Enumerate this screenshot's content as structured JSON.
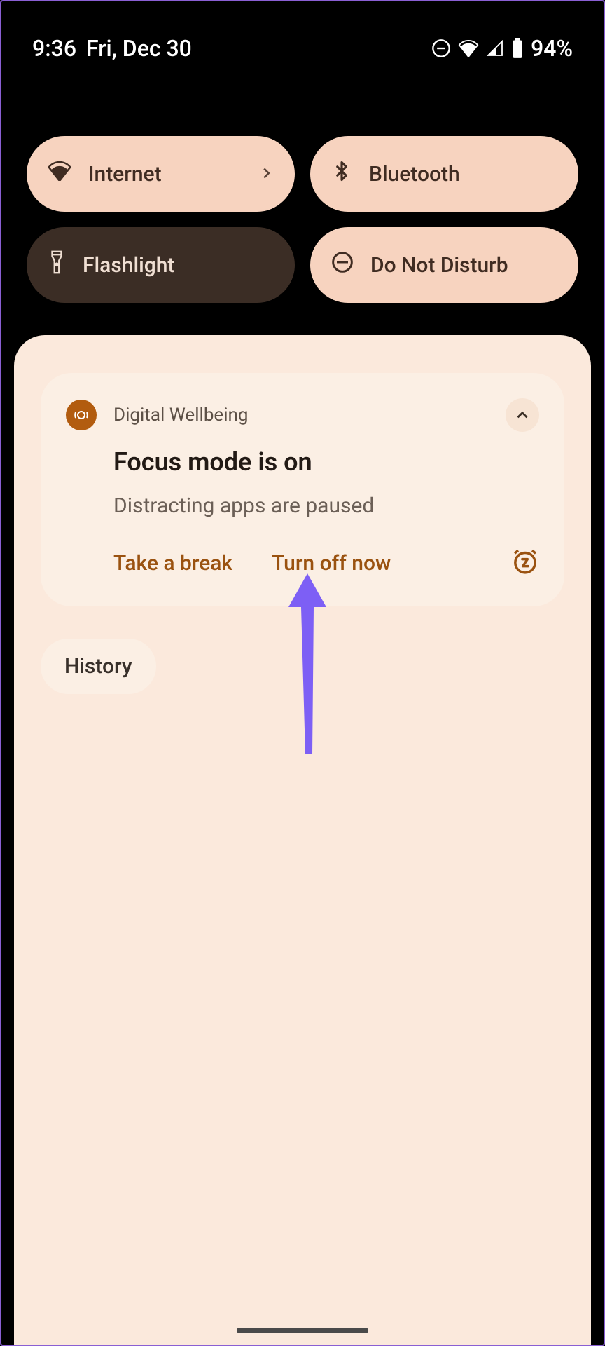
{
  "status": {
    "time": "9:36",
    "date": "Fri, Dec 30",
    "battery": "94%"
  },
  "tiles": {
    "internet": "Internet",
    "bluetooth": "Bluetooth",
    "flashlight": "Flashlight",
    "dnd": "Do Not Disturb"
  },
  "notification": {
    "app": "Digital Wellbeing",
    "title": "Focus mode is on",
    "text": "Distracting apps are paused",
    "action_break": "Take a break",
    "action_off": "Turn off now"
  },
  "history_label": "History"
}
